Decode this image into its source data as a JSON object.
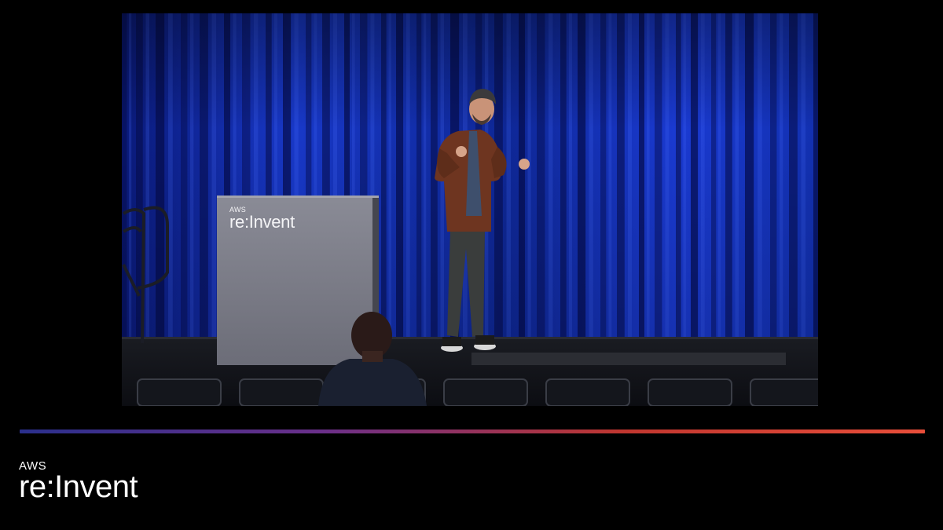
{
  "video": {
    "podium_logo": {
      "aws": "AWS",
      "wordmark": "re:Invent"
    }
  },
  "divider": {
    "gradient_colors": [
      "#2a2f8c",
      "#6a2f8a",
      "#c0362f",
      "#e84e3a"
    ]
  },
  "brand": {
    "aws": "AWS",
    "wordmark": "re:Invent"
  },
  "colors": {
    "background": "#000000",
    "curtain": "#1632c8",
    "podium": "#7d7e88",
    "text": "#ffffff"
  }
}
